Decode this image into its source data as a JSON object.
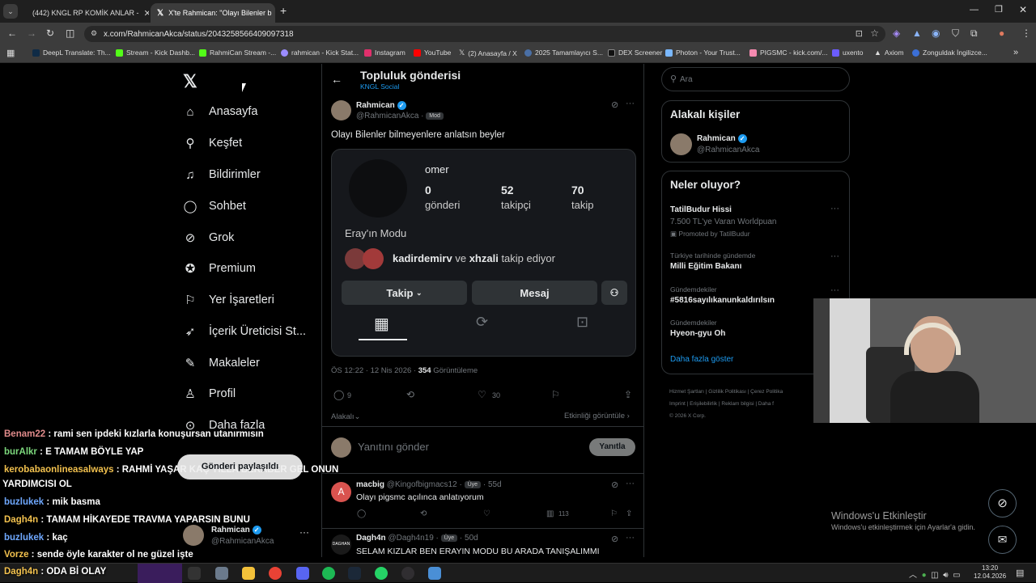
{
  "browser": {
    "tabs": [
      {
        "title": "(442) KNGL RP KOMİK ANLAR -"
      },
      {
        "title": "X'te Rahmican: \"Olayı Bilenler b"
      }
    ],
    "url": "x.com/RahmicanAkca/status/2043258566409097318",
    "bookmarks": [
      "DeepL Translate: Th...",
      "Stream - Kick Dashb...",
      "RahmiCan Stream -...",
      "rahmican - Kick Stat...",
      "Instagram",
      "YouTube",
      "(2) Anasayfa / X",
      "2025 Tamamlayıcı S...",
      "DEX Screener",
      "Photon - Your Trust...",
      "PIGSMC - kick.com/...",
      "uxento",
      "Axiom",
      "Zonguldak İngilizce..."
    ]
  },
  "sidebar": {
    "items": [
      {
        "label": "Anasayfa",
        "icon": "home-icon"
      },
      {
        "label": "Keşfet",
        "icon": "search-icon"
      },
      {
        "label": "Bildirimler",
        "icon": "bell-icon"
      },
      {
        "label": "Sohbet",
        "icon": "chat-icon"
      },
      {
        "label": "Grok",
        "icon": "grok-icon"
      },
      {
        "label": "Premium",
        "icon": "premium-icon"
      },
      {
        "label": "Yer İşaretleri",
        "icon": "bookmark-icon"
      },
      {
        "label": "İçerik Üreticisi St...",
        "icon": "rocket-icon"
      },
      {
        "label": "Makaleler",
        "icon": "article-icon"
      },
      {
        "label": "Profil",
        "icon": "profile-icon"
      },
      {
        "label": "Daha fazla",
        "icon": "more-icon"
      }
    ],
    "account": {
      "name": "Rahmican",
      "handle": "@RahmicanAkca"
    }
  },
  "post": {
    "header_title": "Topluluk gönderisi",
    "header_subtitle": "KNGL Social",
    "author_name": "Rahmican",
    "author_handle": "@RahmicanAkca",
    "author_badge": "Mod",
    "text": "Olayı Bilenler bilmeyenlere anlatsın beyler",
    "card": {
      "username": "omer",
      "posts_count": "0",
      "posts_label": "gönderi",
      "followers_count": "52",
      "followers_label": "takipçi",
      "following_count": "70",
      "following_label": "takip",
      "bio": "Eray'ın Modu",
      "followed_by_1": "kadirdemirv",
      "followed_by_and": "ve",
      "followed_by_2": "xhzali",
      "followed_by_suffix": "takip ediyor",
      "follow_button": "Takip",
      "message_button": "Mesaj"
    },
    "timestamp": "ÖS 12:22 · 12 Nis 2026 ·",
    "views_count": "354",
    "views_label": "Görüntüleme",
    "replies": "9",
    "likes": "30",
    "reply_audience": "Alakalı",
    "activity_link": "Etkinliği görüntüle",
    "reply_placeholder": "Yanıtını gönder",
    "reply_button": "Yanıtla"
  },
  "replies": [
    {
      "name": "macbig",
      "handle": "@Kingofbigmacs12",
      "badge": "Üye",
      "time": "55d",
      "text": "Olayı pigsmc açılınca anlatıyorum",
      "views": "113",
      "avatar_letter": "A"
    },
    {
      "name": "Dagh4n",
      "handle": "@Dagh4n19",
      "badge": "Üye",
      "time": "50d",
      "text": "SELAM KIZLAR BEN ERAYIN MODU BU ARADA TANIŞALIMMI",
      "avatar_letter": "DAGHAN"
    }
  ],
  "right": {
    "search_placeholder": "Ara",
    "related_title": "Alakalı kişiler",
    "related_name": "Rahmican",
    "related_handle": "@RahmicanAkca",
    "trends_title": "Neler oluyor?",
    "trends": [
      {
        "title": "TatilBudur Hissi",
        "sub": "7.500 TL'ye Varan Worldpuan",
        "promo": "Promoted by TatilBudur"
      },
      {
        "cat": "Türkiye tarihinde gündemde",
        "title": "Milli Eğitim Bakanı"
      },
      {
        "cat": "Gündemdekiler",
        "title": "#5816sayılıkanunkaldırılsın"
      },
      {
        "cat": "Gündemdekiler",
        "title": "Hyeon-gyu Oh"
      }
    ],
    "show_more": "Daha fazla göster",
    "footer_1": "Hizmet Şartları  |  Gizlilik Politikası  |  Çerez Politika",
    "footer_2": "Imprint  |  Erişilebilirlik  |  Reklam bilgisi  |  Daha f",
    "footer_3": "© 2026 X Corp."
  },
  "toast": "Gönderi paylaşıldı",
  "windows_activate": {
    "title": "Windows'u Etkinleştir",
    "sub": "Windows'u etkinleştirmek için Ayarlar'a gidin."
  },
  "chat": [
    {
      "user": "Benam22",
      "msg": " : rami sen ipdeki kızlarla konuşursan utanırmısın",
      "color": "#e08b8b"
    },
    {
      "user": "burAlkr",
      "msg": " : E TAMAM BÖYLE YAP",
      "color": "#7dd87d"
    },
    {
      "user": "kerobabaonlineasalways",
      "msg": " : RAHMİ YAŞAR KAÇ YILLA BERABER GEL ONUN",
      "color": "#f2c14e"
    },
    {
      "user": "",
      "msg": "YARDIMCISI OL",
      "color": "#ffffff"
    },
    {
      "user": "buzlukek",
      "msg": " : mik basma",
      "color": "#6fa8ff"
    },
    {
      "user": "Dagh4n",
      "msg": " : TAMAM HİKAYEDE TRAVMA YAPARSIN BUNU",
      "color": "#f2c14e"
    },
    {
      "user": "buzlukek",
      "msg": " : kaç",
      "color": "#6fa8ff"
    },
    {
      "user": "Vorze",
      "msg": " : sende öyle karakter ol ne güzel işte",
      "color": "#f2c14e"
    },
    {
      "user": "Dagh4n",
      "msg": " : ODA Bİ OLAY",
      "color": "#f2c14e"
    }
  ],
  "clock": {
    "time": "13:20",
    "date": "12.04.2026"
  }
}
